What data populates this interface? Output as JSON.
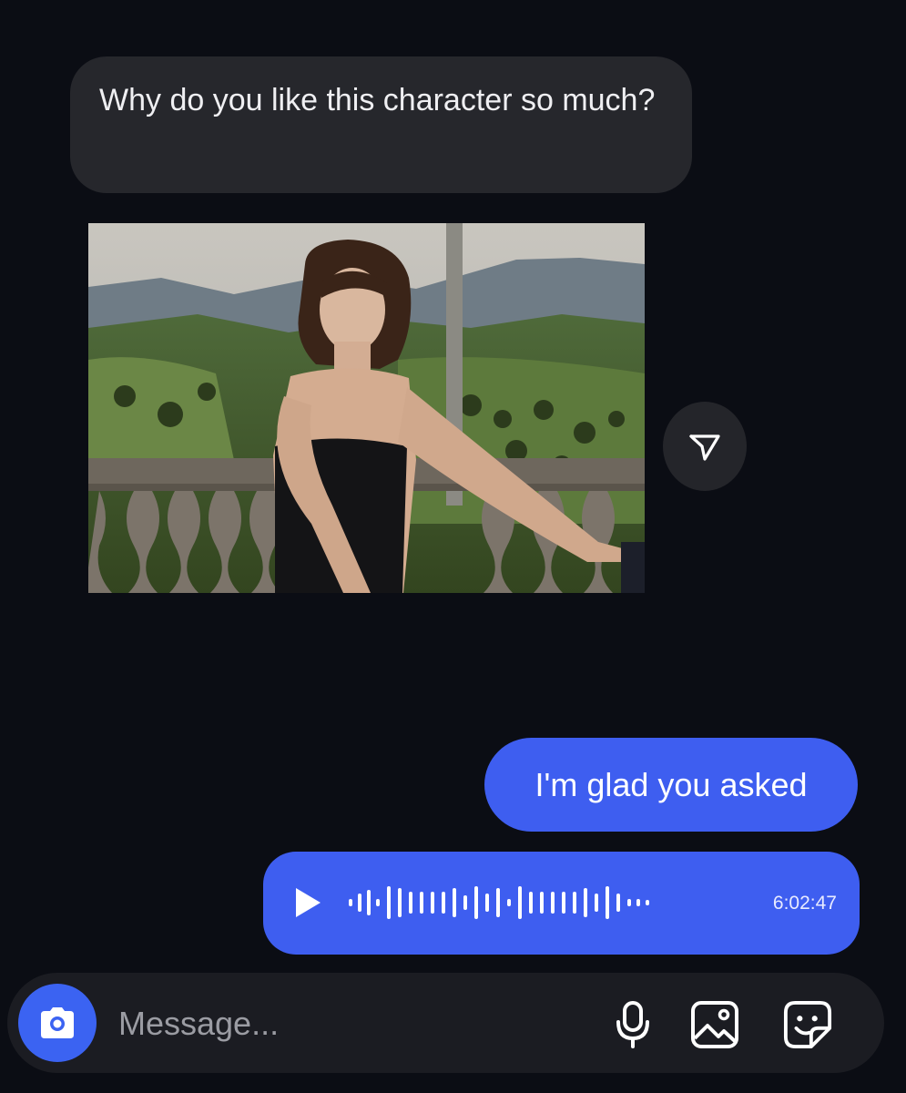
{
  "messages": {
    "incoming_text": "Why do you like this  character   so much?",
    "outgoing_text": "I'm glad you asked",
    "voice_note": {
      "duration": "6:02:47"
    }
  },
  "composer": {
    "placeholder": "Message..."
  },
  "icons": {
    "share": "send-icon",
    "camera": "camera-icon",
    "mic": "microphone-icon",
    "gallery": "image-icon",
    "sticker": "sticker-icon"
  },
  "colors": {
    "background": "#0b0d14",
    "incoming_bubble": "#26272c",
    "outgoing_bubble": "#3e5ef0",
    "camera_button": "#3b63f2"
  }
}
